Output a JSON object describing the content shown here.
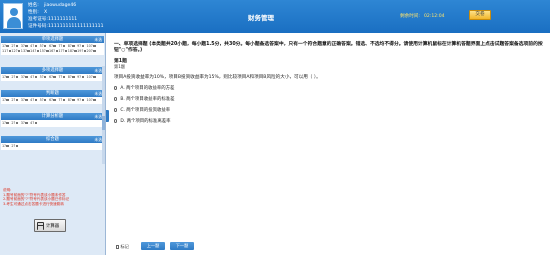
{
  "header": {
    "name_label": "姓名:",
    "name_value": "jiaowudage46",
    "gender_label": "性别:",
    "gender_value": "X",
    "admission_label": "准考证号:",
    "admission_value": "1111111111",
    "id_label": "证件号码:",
    "id_value": "1111111111111111111",
    "app_title": "财务管理",
    "timer_label": "剩余时间:",
    "timer_value": "02:12:04",
    "submit_label": "交卷"
  },
  "sidebar": {
    "sections": [
      {
        "name": "单项选择题",
        "status": "未选",
        "count": 20
      },
      {
        "name": "多项选择题",
        "status": "未选",
        "count": 10
      },
      {
        "name": "判断题",
        "status": "未选",
        "count": 10
      },
      {
        "name": "计算分析题",
        "status": "未选",
        "count": 4
      },
      {
        "name": "综合题",
        "status": "未选",
        "count": 2
      }
    ],
    "notes_title": "说明:",
    "notes": [
      "1.题号前面的\"?\"符号代表该小题未作答",
      "2.题号前面的\"?\"符号代表该小题已作标记",
      "3.考生可通过点击答题卡进行快速跳转"
    ],
    "calculator_label": "计算器"
  },
  "question": {
    "instruction": "一、单项选择题 (本类题共20小题，每小题1.5分，共30分。每小题备选答案中，只有一个符合题意的正确答案。错选、不选均不得分。请使用计算机鼠标在计算机答题界面上点击试题答案备选项前的按钮\"○\"作答。)",
    "number_title": "第1题",
    "number_sub": "第1题",
    "stem": "项目A投资收益率为10%，项目B投资收益率为15%，则比较项目A和项目B风险的大小，可以用（ ）。",
    "options": [
      {
        "letter": "A.",
        "text": "两个项目的收益率的方差"
      },
      {
        "letter": "B.",
        "text": "两个项目收益率的标准差"
      },
      {
        "letter": "C.",
        "text": "两个项目的投资收益率"
      },
      {
        "letter": "D.",
        "text": "两个项目的标准离差率"
      }
    ]
  },
  "footer": {
    "mark_label": "标记",
    "prev_label": "上一题",
    "next_label": "下一题"
  }
}
